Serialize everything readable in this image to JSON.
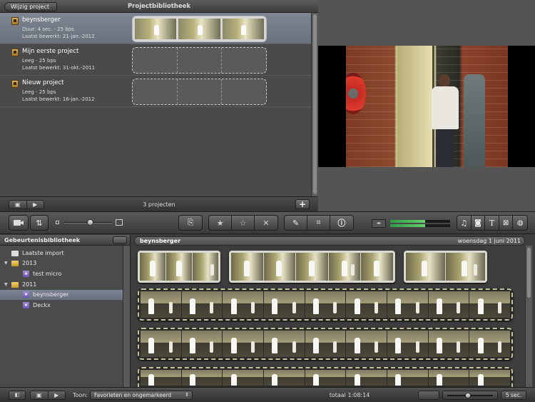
{
  "project_library": {
    "edit_button": "Wijzig project",
    "title": "Projectbibliotheek",
    "projects": [
      {
        "name": "beynsberger",
        "line1": "Duur: 4 sec. - 25 bps",
        "line2": "Laatst bewerkt: 21-jan.-2012",
        "selected": true
      },
      {
        "name": "Mijn eerste project",
        "line1": "Leeg - 25 bps",
        "line2": "Laatst bewerkt: 31-okt.-2011",
        "selected": false
      },
      {
        "name": "Nieuw project",
        "line1": "Leeg - 25 bps",
        "line2": "Laatst bewerkt: 16-jan.-2012",
        "selected": false
      }
    ],
    "count_label": "3 projecten",
    "add_icon": "plus-icon"
  },
  "toolbar": {
    "icons": [
      "camera-import-icon",
      "swap-icon",
      "add-to-project-icon",
      "favorite-star-icon",
      "unmark-star-icon",
      "reject-x-icon",
      "keyword-brush-icon",
      "crop-icon",
      "inspector-info-icon",
      "music-icon",
      "photo-icon",
      "title-t-icon",
      "transition-icon",
      "map-globe-icon"
    ],
    "zoom_level": 0.55,
    "audio_level": 0.58
  },
  "event_library": {
    "title": "Gebeurtenisbibliotheek",
    "items": [
      {
        "label": "Laatste import",
        "type": "import",
        "indent": 0
      },
      {
        "label": "2013",
        "type": "year",
        "indent": 0
      },
      {
        "label": "test micro",
        "type": "event",
        "indent": 1
      },
      {
        "label": "2011",
        "type": "year",
        "indent": 0
      },
      {
        "label": "beynsberger",
        "type": "event",
        "indent": 1,
        "selected": true
      },
      {
        "label": "Deckx",
        "type": "event",
        "indent": 1
      }
    ]
  },
  "event_browser": {
    "event_name": "beynsberger",
    "event_date": "woensdag 1 juni 2011"
  },
  "bottom_bar": {
    "show_label": "Toon:",
    "show_value": "Favorieten en ongemarkeerd",
    "total_label": "totaal 1:08:14",
    "duration_value": "5 sec.",
    "zoom_level": 0.45
  },
  "colors": {
    "selection": "#7e8692",
    "audio_meter": "#4fc25b",
    "event_star": "#7c66c4"
  }
}
